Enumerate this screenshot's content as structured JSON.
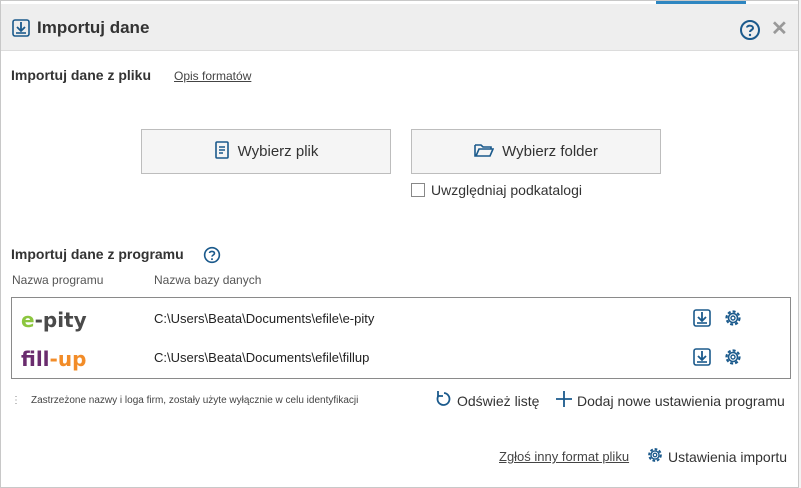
{
  "window": {
    "title": "Importuj dane",
    "help_icon": "help-circle-icon",
    "close_icon": "close-icon"
  },
  "file_section": {
    "title": "Importuj dane z pliku",
    "formats_link": "Opis formatów",
    "choose_file_label": "Wybierz plik",
    "choose_folder_label": "Wybierz folder",
    "include_subfolders_label": "Uwzględniaj podkatalogi",
    "include_subfolders_checked": false
  },
  "program_section": {
    "title": "Importuj dane z programu",
    "col_program": "Nazwa programu",
    "col_database": "Nazwa bazy danych",
    "rows": [
      {
        "logo_a": "e",
        "logo_b": "-pity",
        "logo_name": "e-pity",
        "path": "C:\\Users\\Beata\\Documents\\efile\\e-pity"
      },
      {
        "logo_a": "fill",
        "logo_b": "-up",
        "logo_name": "fill-up",
        "path": "C:\\Users\\Beata\\Documents\\efile\\fillup"
      }
    ],
    "disclaimer": "Zastrzeżone nazwy i loga firm, zostały użyte wyłącznie w celu identyfikacji",
    "refresh_label": "Odśwież listę",
    "add_label": "Dodaj nowe ustawienia programu"
  },
  "footer": {
    "report_link": "Zgłoś inny format pliku",
    "import_settings_label": "Ustawienia importu"
  },
  "colors": {
    "accent": "#2e86c1",
    "icon_blue": "#1b5a8c",
    "epity_green": "#8cc63f",
    "fillup_purple": "#6a2c6e",
    "fillup_orange": "#f28c28"
  }
}
